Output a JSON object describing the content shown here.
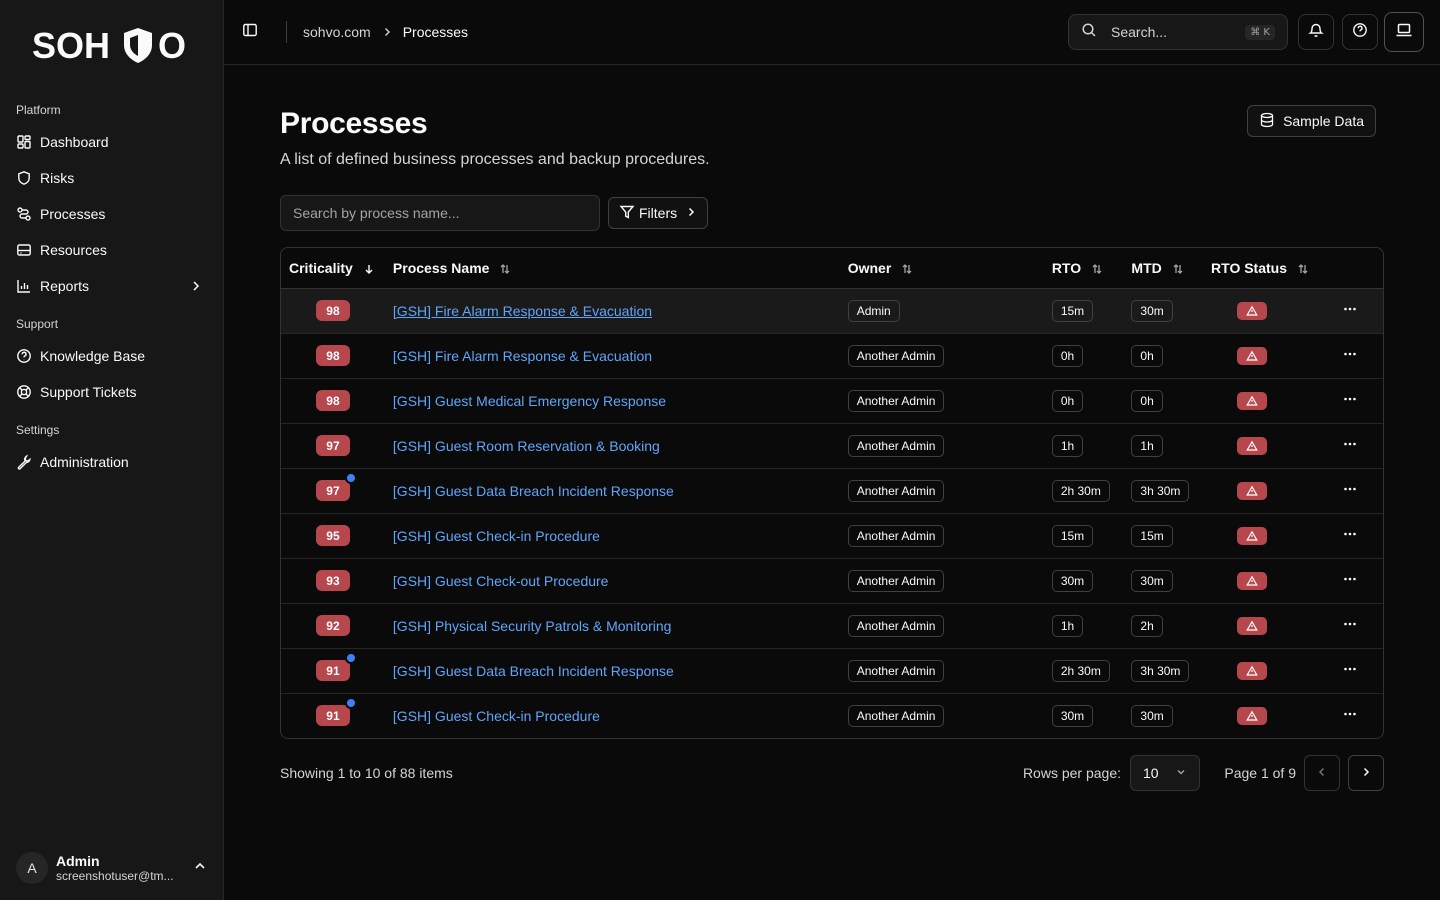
{
  "brand": {
    "name": "SOHVO",
    "letters_left": "SOH",
    "letters_right": "O"
  },
  "sidebar": {
    "groups": [
      {
        "label": "Platform",
        "items": [
          {
            "label": "Dashboard",
            "icon": "dashboard-icon"
          },
          {
            "label": "Risks",
            "icon": "shield-icon"
          },
          {
            "label": "Processes",
            "icon": "workflow-icon"
          },
          {
            "label": "Resources",
            "icon": "database-icon"
          },
          {
            "label": "Reports",
            "icon": "chart-icon"
          }
        ]
      },
      {
        "label": "Support",
        "items": [
          {
            "label": "Knowledge Base",
            "icon": "help-circle-icon"
          },
          {
            "label": "Support Tickets",
            "icon": "lifebuoy-icon"
          }
        ]
      },
      {
        "label": "Settings",
        "items": [
          {
            "label": "Administration",
            "icon": "wrench-icon"
          }
        ]
      }
    ],
    "user": {
      "initial": "A",
      "name": "Admin",
      "email": "screenshotuser@tm..."
    }
  },
  "topbar": {
    "breadcrumb": [
      "sohvo.com",
      "Processes"
    ],
    "search_placeholder": "Search...",
    "search_shortcut": "⌘ K"
  },
  "page": {
    "title": "Processes",
    "subtitle": "A list of defined business processes and backup procedures.",
    "sample_button": "Sample Data",
    "filter_placeholder": "Search by process name...",
    "filters_button": "Filters"
  },
  "table": {
    "columns": [
      "Criticality",
      "Process Name",
      "Owner",
      "RTO",
      "MTD",
      "RTO Status"
    ],
    "rows": [
      {
        "crit": "98",
        "dot": false,
        "name": "[GSH] Fire Alarm Response & Evacuation",
        "owner": "Admin",
        "rto": "15m",
        "mtd": "30m",
        "hl": true
      },
      {
        "crit": "98",
        "dot": false,
        "name": "[GSH] Fire Alarm Response & Evacuation",
        "owner": "Another Admin",
        "rto": "0h",
        "mtd": "0h",
        "hl": false
      },
      {
        "crit": "98",
        "dot": false,
        "name": "[GSH] Guest Medical Emergency Response",
        "owner": "Another Admin",
        "rto": "0h",
        "mtd": "0h",
        "hl": false
      },
      {
        "crit": "97",
        "dot": false,
        "name": "[GSH] Guest Room Reservation & Booking",
        "owner": "Another Admin",
        "rto": "1h",
        "mtd": "1h",
        "hl": false
      },
      {
        "crit": "97",
        "dot": true,
        "name": "[GSH] Guest Data Breach Incident Response",
        "owner": "Another Admin",
        "rto": "2h 30m",
        "mtd": "3h 30m",
        "hl": false
      },
      {
        "crit": "95",
        "dot": false,
        "name": "[GSH] Guest Check-in Procedure",
        "owner": "Another Admin",
        "rto": "15m",
        "mtd": "15m",
        "hl": false
      },
      {
        "crit": "93",
        "dot": false,
        "name": "[GSH] Guest Check-out Procedure",
        "owner": "Another Admin",
        "rto": "30m",
        "mtd": "30m",
        "hl": false
      },
      {
        "crit": "92",
        "dot": false,
        "name": "[GSH] Physical Security Patrols & Monitoring",
        "owner": "Another Admin",
        "rto": "1h",
        "mtd": "2h",
        "hl": false
      },
      {
        "crit": "91",
        "dot": true,
        "name": "[GSH] Guest Data Breach Incident Response",
        "owner": "Another Admin",
        "rto": "2h 30m",
        "mtd": "3h 30m",
        "hl": false
      },
      {
        "crit": "91",
        "dot": true,
        "name": "[GSH] Guest Check-in Procedure",
        "owner": "Another Admin",
        "rto": "30m",
        "mtd": "30m",
        "hl": false
      }
    ]
  },
  "pagination": {
    "showing": "Showing 1 to 10 of 88 items",
    "rows_per_page_label": "Rows per page:",
    "rows_per_page_value": "10",
    "page_label": "Page 1 of 9"
  },
  "colors": {
    "badge_red": "#b5474d",
    "link_blue": "#60a5fa",
    "background": "#0a0a0a",
    "sidebar": "#171717"
  }
}
